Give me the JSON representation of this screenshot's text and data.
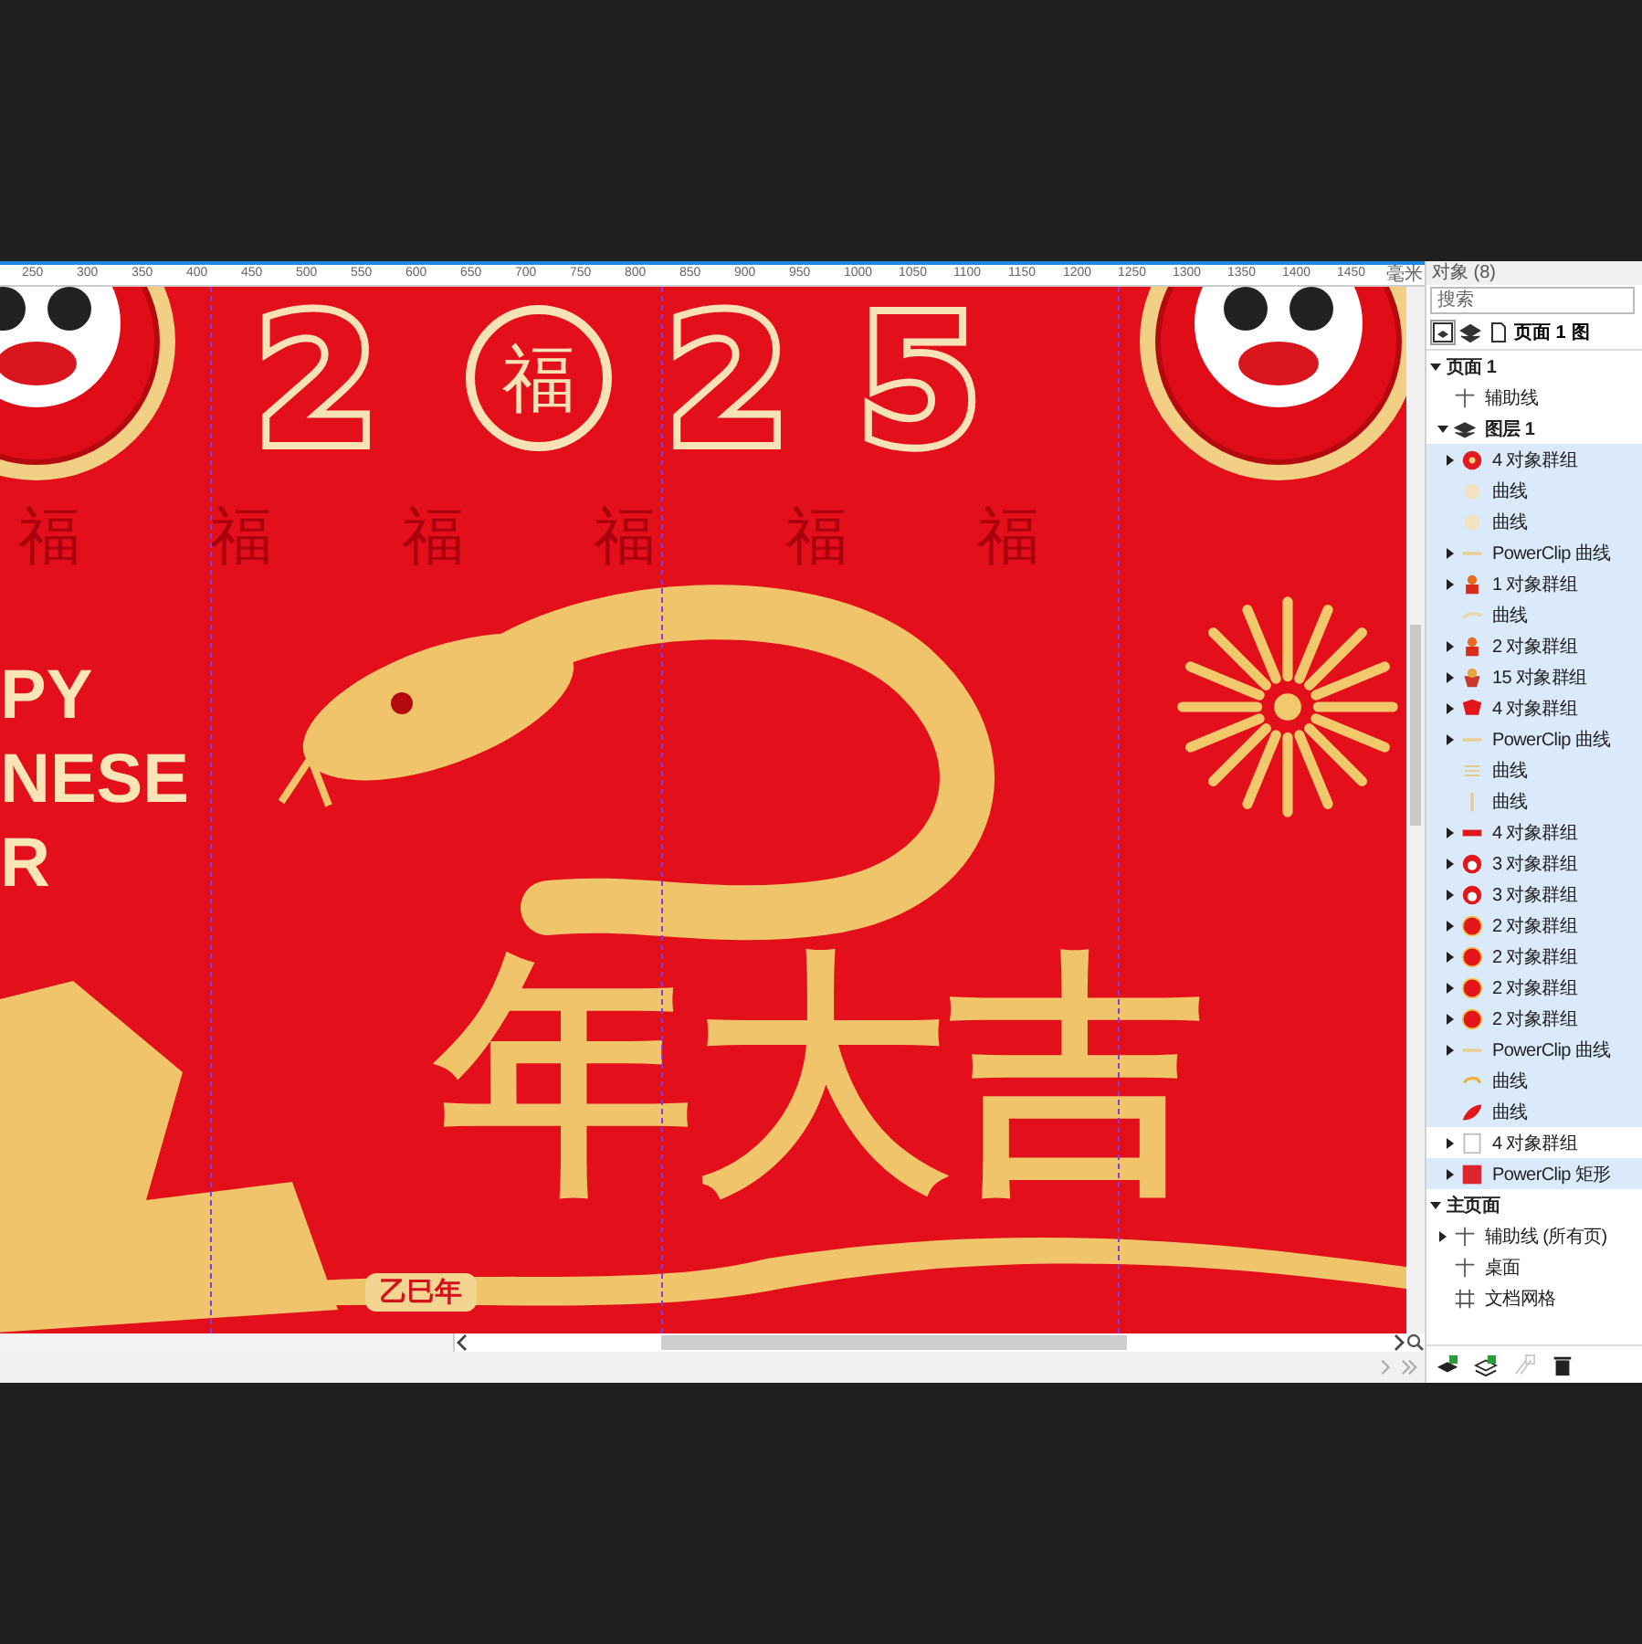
{
  "canvas": {
    "ruler": {
      "ticks": [
        "250",
        "300",
        "350",
        "400",
        "450",
        "500",
        "550",
        "600",
        "650",
        "700",
        "750",
        "800",
        "850",
        "900",
        "950",
        "1000",
        "1050",
        "1100",
        "1150",
        "1200",
        "1250",
        "1300",
        "1350",
        "1400",
        "1450"
      ],
      "unit": "毫米"
    },
    "artwork": {
      "pattern": [
        "福",
        "福",
        "福",
        "福",
        "福",
        "福"
      ],
      "year_parts": [
        {
          "kind": "digit",
          "text": "2"
        },
        {
          "kind": "seal",
          "text": "福"
        },
        {
          "kind": "digit",
          "text": "2"
        },
        {
          "kind": "digit",
          "text": "5"
        }
      ],
      "greeting_lines": [
        "PY",
        "NESE",
        "R"
      ],
      "headline": "年大吉",
      "stamp": "乙巳年"
    }
  },
  "panel": {
    "title": "对象 (8)",
    "search": {
      "placeholder": "搜索"
    },
    "toolbar": {
      "page_label": "页面 1",
      "cut_label": "图"
    },
    "tree": [
      {
        "label": "页面 1",
        "kind": "page",
        "expanded": true,
        "selected": false,
        "children": [
          {
            "label": "辅助线",
            "kind": "guide",
            "selected": false
          },
          {
            "label": "图层 1",
            "kind": "layer",
            "expanded": true,
            "selected": false,
            "children": [
              {
                "label": "4 对象群组",
                "kind": "flower",
                "expanded": false,
                "selected": true
              },
              {
                "label": "曲线",
                "kind": "sparkle",
                "selected": true
              },
              {
                "label": "曲线",
                "kind": "sparkle",
                "selected": true
              },
              {
                "label": "PowerClip 曲线",
                "kind": "strip",
                "expanded": false,
                "selected": true
              },
              {
                "label": "1 对象群组",
                "kind": "figure",
                "expanded": false,
                "selected": true
              },
              {
                "label": "曲线",
                "kind": "wisp",
                "selected": true
              },
              {
                "label": "2 对象群组",
                "kind": "figure",
                "expanded": false,
                "selected": true
              },
              {
                "label": "15 对象群组",
                "kind": "bowl",
                "expanded": false,
                "selected": true
              },
              {
                "label": "4 对象群组",
                "kind": "lantern",
                "expanded": false,
                "selected": true
              },
              {
                "label": "PowerClip 曲线",
                "kind": "strip",
                "expanded": false,
                "selected": true
              },
              {
                "label": "曲线",
                "kind": "lines",
                "selected": true
              },
              {
                "label": "曲线",
                "kind": "stick",
                "selected": true
              },
              {
                "label": "4 对象群组",
                "kind": "banner",
                "expanded": false,
                "selected": true
              },
              {
                "label": "3 对象群组",
                "kind": "lion",
                "expanded": false,
                "selected": true
              },
              {
                "label": "3 对象群组",
                "kind": "lion",
                "expanded": false,
                "selected": true
              },
              {
                "label": "2 对象群组",
                "kind": "disc",
                "expanded": false,
                "selected": true
              },
              {
                "label": "2 对象群组",
                "kind": "disc",
                "expanded": false,
                "selected": true
              },
              {
                "label": "2 对象群组",
                "kind": "disc",
                "expanded": false,
                "selected": true
              },
              {
                "label": "2 对象群组",
                "kind": "disc",
                "expanded": false,
                "selected": true
              },
              {
                "label": "PowerClip 曲线",
                "kind": "strip",
                "expanded": false,
                "selected": true
              },
              {
                "label": "曲线",
                "kind": "swirl",
                "selected": true
              },
              {
                "label": "曲线",
                "kind": "petal",
                "selected": true
              },
              {
                "label": "4 对象群组",
                "kind": "grid",
                "expanded": false,
                "selected": false
              },
              {
                "label": "PowerClip 矩形",
                "kind": "square",
                "expanded": false,
                "selected": true
              }
            ]
          }
        ]
      },
      {
        "label": "主页面",
        "kind": "page",
        "expanded": true,
        "selected": false,
        "children": [
          {
            "label": "辅助线 (所有页)",
            "kind": "guide",
            "expanded": false,
            "selected": false
          },
          {
            "label": "桌面",
            "kind": "desktop",
            "selected": false
          },
          {
            "label": "文档网格",
            "kind": "docgrid",
            "selected": false
          }
        ]
      }
    ],
    "footer_tools": [
      {
        "kind": "new-layer",
        "disabled": false
      },
      {
        "kind": "new-master-layer",
        "disabled": false
      },
      {
        "kind": "layer-link",
        "disabled": true
      },
      {
        "kind": "delete",
        "disabled": false
      }
    ]
  }
}
